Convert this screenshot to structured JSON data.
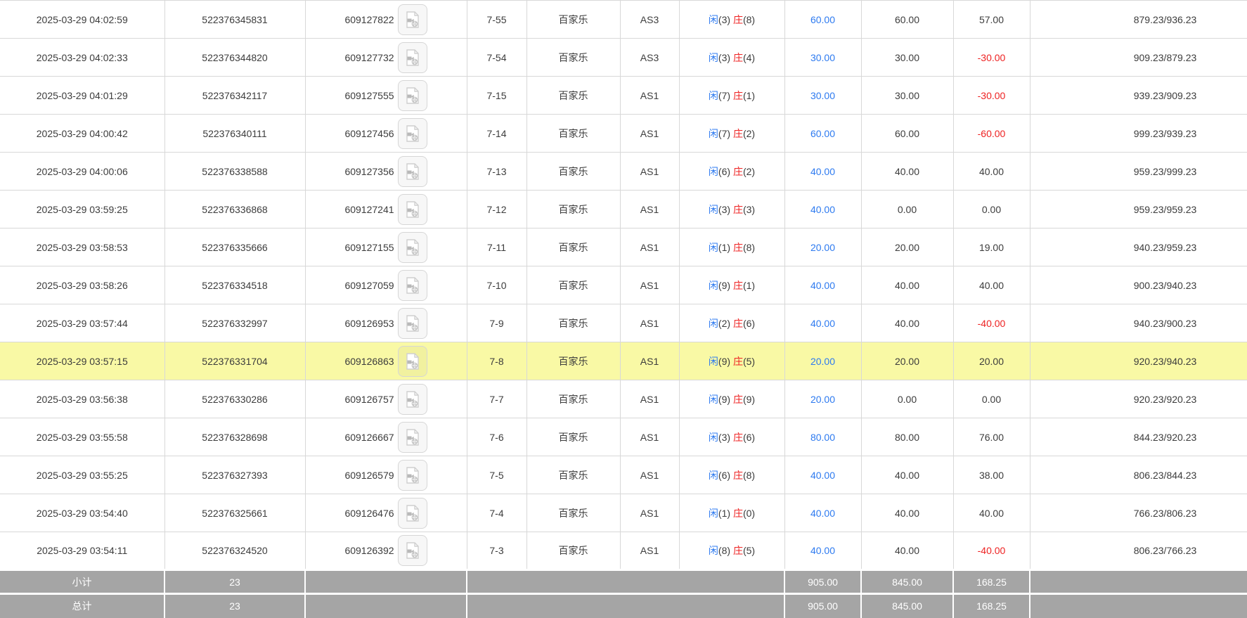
{
  "table": {
    "result_labels": {
      "player": "闲",
      "banker": "庄"
    },
    "game_label": "百家乐",
    "rows": [
      {
        "time": "2025-03-29 04:02:59",
        "bet_id": "522376345831",
        "game_no": "609127822",
        "round": "7-55",
        "game": "百家乐",
        "table": "AS3",
        "player": 3,
        "banker": 8,
        "bet": "60.00",
        "valid": "60.00",
        "winloss": "57.00",
        "balance": "879.23/936.23",
        "highlight": false
      },
      {
        "time": "2025-03-29 04:02:33",
        "bet_id": "522376344820",
        "game_no": "609127732",
        "round": "7-54",
        "game": "百家乐",
        "table": "AS3",
        "player": 3,
        "banker": 4,
        "bet": "30.00",
        "valid": "30.00",
        "winloss": "-30.00",
        "balance": "909.23/879.23",
        "highlight": false
      },
      {
        "time": "2025-03-29 04:01:29",
        "bet_id": "522376342117",
        "game_no": "609127555",
        "round": "7-15",
        "game": "百家乐",
        "table": "AS1",
        "player": 7,
        "banker": 1,
        "bet": "30.00",
        "valid": "30.00",
        "winloss": "-30.00",
        "balance": "939.23/909.23",
        "highlight": false
      },
      {
        "time": "2025-03-29 04:00:42",
        "bet_id": "522376340111",
        "game_no": "609127456",
        "round": "7-14",
        "game": "百家乐",
        "table": "AS1",
        "player": 7,
        "banker": 2,
        "bet": "60.00",
        "valid": "60.00",
        "winloss": "-60.00",
        "balance": "999.23/939.23",
        "highlight": false
      },
      {
        "time": "2025-03-29 04:00:06",
        "bet_id": "522376338588",
        "game_no": "609127356",
        "round": "7-13",
        "game": "百家乐",
        "table": "AS1",
        "player": 6,
        "banker": 2,
        "bet": "40.00",
        "valid": "40.00",
        "winloss": "40.00",
        "balance": "959.23/999.23",
        "highlight": false
      },
      {
        "time": "2025-03-29 03:59:25",
        "bet_id": "522376336868",
        "game_no": "609127241",
        "round": "7-12",
        "game": "百家乐",
        "table": "AS1",
        "player": 3,
        "banker": 3,
        "bet": "40.00",
        "valid": "0.00",
        "winloss": "0.00",
        "balance": "959.23/959.23",
        "highlight": false
      },
      {
        "time": "2025-03-29 03:58:53",
        "bet_id": "522376335666",
        "game_no": "609127155",
        "round": "7-11",
        "game": "百家乐",
        "table": "AS1",
        "player": 1,
        "banker": 8,
        "bet": "20.00",
        "valid": "20.00",
        "winloss": "19.00",
        "balance": "940.23/959.23",
        "highlight": false
      },
      {
        "time": "2025-03-29 03:58:26",
        "bet_id": "522376334518",
        "game_no": "609127059",
        "round": "7-10",
        "game": "百家乐",
        "table": "AS1",
        "player": 9,
        "banker": 1,
        "bet": "40.00",
        "valid": "40.00",
        "winloss": "40.00",
        "balance": "900.23/940.23",
        "highlight": false
      },
      {
        "time": "2025-03-29 03:57:44",
        "bet_id": "522376332997",
        "game_no": "609126953",
        "round": "7-9",
        "game": "百家乐",
        "table": "AS1",
        "player": 2,
        "banker": 6,
        "bet": "40.00",
        "valid": "40.00",
        "winloss": "-40.00",
        "balance": "940.23/900.23",
        "highlight": false
      },
      {
        "time": "2025-03-29 03:57:15",
        "bet_id": "522376331704",
        "game_no": "609126863",
        "round": "7-8",
        "game": "百家乐",
        "table": "AS1",
        "player": 9,
        "banker": 5,
        "bet": "20.00",
        "valid": "20.00",
        "winloss": "20.00",
        "balance": "920.23/940.23",
        "highlight": true
      },
      {
        "time": "2025-03-29 03:56:38",
        "bet_id": "522376330286",
        "game_no": "609126757",
        "round": "7-7",
        "game": "百家乐",
        "table": "AS1",
        "player": 9,
        "banker": 9,
        "bet": "20.00",
        "valid": "0.00",
        "winloss": "0.00",
        "balance": "920.23/920.23",
        "highlight": false
      },
      {
        "time": "2025-03-29 03:55:58",
        "bet_id": "522376328698",
        "game_no": "609126667",
        "round": "7-6",
        "game": "百家乐",
        "table": "AS1",
        "player": 3,
        "banker": 6,
        "bet": "80.00",
        "valid": "80.00",
        "winloss": "76.00",
        "balance": "844.23/920.23",
        "highlight": false
      },
      {
        "time": "2025-03-29 03:55:25",
        "bet_id": "522376327393",
        "game_no": "609126579",
        "round": "7-5",
        "game": "百家乐",
        "table": "AS1",
        "player": 6,
        "banker": 8,
        "bet": "40.00",
        "valid": "40.00",
        "winloss": "38.00",
        "balance": "806.23/844.23",
        "highlight": false
      },
      {
        "time": "2025-03-29 03:54:40",
        "bet_id": "522376325661",
        "game_no": "609126476",
        "round": "7-4",
        "game": "百家乐",
        "table": "AS1",
        "player": 1,
        "banker": 0,
        "bet": "40.00",
        "valid": "40.00",
        "winloss": "40.00",
        "balance": "766.23/806.23",
        "highlight": false
      },
      {
        "time": "2025-03-29 03:54:11",
        "bet_id": "522376324520",
        "game_no": "609126392",
        "round": "7-3",
        "game": "百家乐",
        "table": "AS1",
        "player": 8,
        "banker": 5,
        "bet": "40.00",
        "valid": "40.00",
        "winloss": "-40.00",
        "balance": "806.23/766.23",
        "highlight": false
      }
    ],
    "summary": [
      {
        "label": "小计",
        "count": "23",
        "bet": "905.00",
        "valid": "845.00",
        "winloss": "168.25"
      },
      {
        "label": "总计",
        "count": "23",
        "bet": "905.00",
        "valid": "845.00",
        "winloss": "168.25"
      }
    ],
    "colors": {
      "player_blue": "#2d7af0",
      "banker_red": "#ee2222",
      "negative_red": "#ee2222",
      "bet_blue": "#2d7af0",
      "highlight_yellow": "#f9f9a5",
      "summary_grey": "#a5a5a5"
    }
  }
}
